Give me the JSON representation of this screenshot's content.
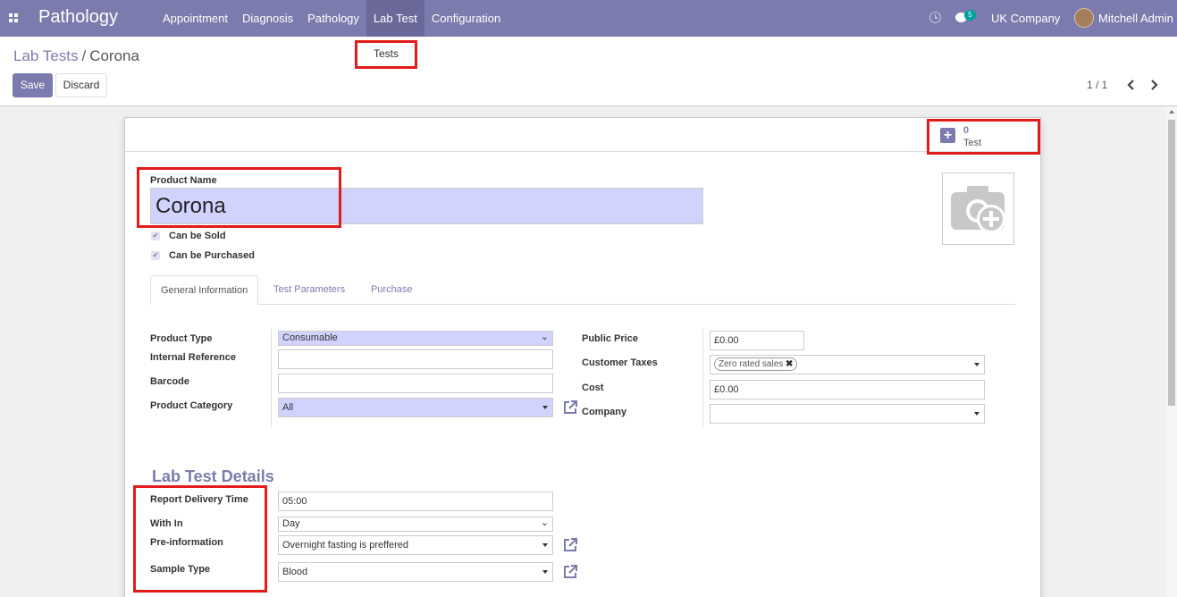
{
  "app": {
    "title": "Pathology"
  },
  "navbar": {
    "menu": [
      {
        "label": "Appointment"
      },
      {
        "label": "Diagnosis"
      },
      {
        "label": "Pathology"
      },
      {
        "label": "Lab Test"
      },
      {
        "label": "Configuration"
      }
    ],
    "active_menu": "Lab Test",
    "chat_count": "5",
    "company": "UK Company",
    "user": "Mitchell Admin"
  },
  "dropdown": {
    "items": [
      {
        "label": "Tests"
      }
    ]
  },
  "breadcrumb": {
    "parent": "Lab Tests",
    "separator": "/",
    "current": "Corona"
  },
  "toolbar": {
    "save_label": "Save",
    "discard_label": "Discard"
  },
  "pager": {
    "value": "1 / 1"
  },
  "smart_button": {
    "value": "0",
    "label": "Test"
  },
  "form": {
    "product_name_label": "Product Name",
    "product_name": "Corona",
    "can_be_sold_label": "Can be Sold",
    "can_be_purchased_label": "Can be Purchased",
    "can_be_sold": true,
    "can_be_purchased": true
  },
  "tabs": [
    {
      "label": "General Information"
    },
    {
      "label": "Test Parameters"
    },
    {
      "label": "Purchase"
    }
  ],
  "general": {
    "product_type_label": "Product Type",
    "product_type": "Consumable",
    "internal_reference_label": "Internal Reference",
    "internal_reference": "",
    "barcode_label": "Barcode",
    "barcode": "",
    "product_category_label": "Product Category",
    "product_category": "All",
    "public_price_label": "Public Price",
    "public_price": "£0.00",
    "customer_taxes_label": "Customer Taxes",
    "customer_taxes_tag": "Zero rated sales",
    "cost_label": "Cost",
    "cost": "£0.00",
    "company_label": "Company",
    "company": ""
  },
  "lab_test": {
    "section_title": "Lab Test Details",
    "report_delivery_time_label": "Report Delivery Time",
    "report_delivery_time": "05:00",
    "within_label": "With In",
    "within": "Day",
    "pre_information_label": "Pre-information",
    "pre_information": "Overnight fasting is preffered",
    "sample_type_label": "Sample Type",
    "sample_type": "Blood"
  },
  "colors": {
    "brand": "#7c7bad",
    "required_field": "#d2d2ff",
    "highlight": "#e31b1b",
    "badge": "#00a09d"
  }
}
